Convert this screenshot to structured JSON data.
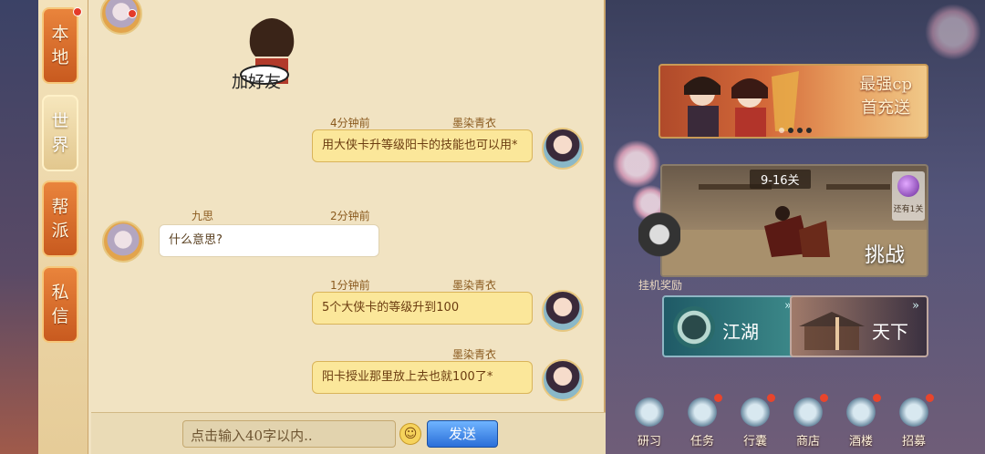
{
  "tabs": [
    {
      "label": [
        "本",
        "地"
      ],
      "active": false,
      "badge": true
    },
    {
      "label": [
        "世",
        "界"
      ],
      "active": true,
      "badge": false
    },
    {
      "label": [
        "帮",
        "派"
      ],
      "active": false,
      "badge": false
    },
    {
      "label": [
        "私",
        "信"
      ],
      "active": false,
      "badge": false
    }
  ],
  "sticker": {
    "text": "加好友"
  },
  "messages": [
    {
      "time": "4分钟前",
      "name": "墨染青衣",
      "text": "用大侠卡升等级阳卡的技能也可以用*",
      "side": "me"
    },
    {
      "time": "2分钟前",
      "name": "九思",
      "text": "什么意思?",
      "side": "other"
    },
    {
      "time": "1分钟前",
      "name": "墨染青衣",
      "text": "5个大侠卡的等级升到100",
      "side": "me"
    },
    {
      "time": "",
      "name": "墨染青衣",
      "text": "阳卡授业那里放上去也就100了*",
      "side": "me"
    }
  ],
  "input": {
    "placeholder": "点击输入40字以内..",
    "send_label": "发送",
    "emoji": "☺"
  },
  "banner": {
    "line1": "最强cp",
    "line2": "首充送"
  },
  "challenge": {
    "level": "9-16关",
    "label": "挑战",
    "reward_label": "还有1关"
  },
  "afk": {
    "label": "挂机奖励"
  },
  "modes": {
    "jianghu": "江湖",
    "tianxia": "天下",
    "arrow": "»"
  },
  "bottom_nav": [
    {
      "label": "研习",
      "badge": false
    },
    {
      "label": "任务",
      "badge": true
    },
    {
      "label": "行囊",
      "badge": true
    },
    {
      "label": "商店",
      "badge": true
    },
    {
      "label": "酒楼",
      "badge": true
    },
    {
      "label": "招募",
      "badge": true
    }
  ]
}
